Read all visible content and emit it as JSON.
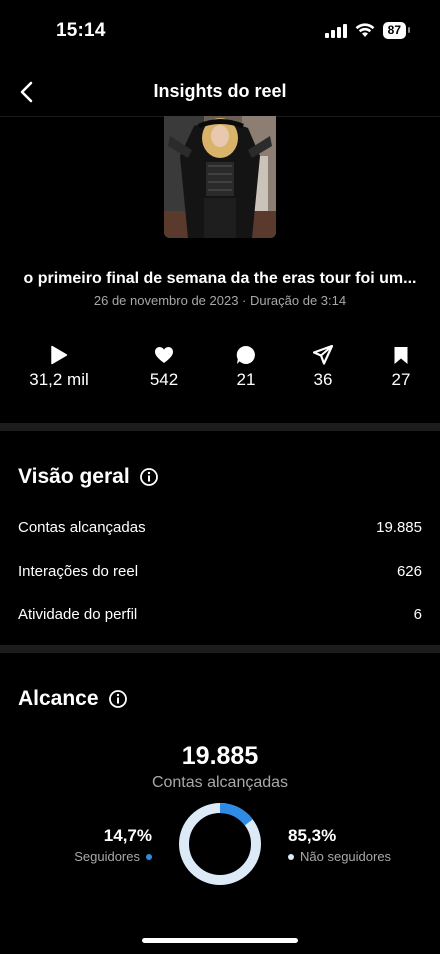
{
  "status_bar": {
    "time": "15:14",
    "battery": "87"
  },
  "nav": {
    "title": "Insights do reel",
    "back_icon": "chevron-left-icon"
  },
  "reel": {
    "title": "o primeiro final de semana da the eras tour foi um...",
    "meta": "26 de novembro de 2023 · Duração de 3:14"
  },
  "stats": [
    {
      "icon": "play-icon",
      "value": "31,2 mil"
    },
    {
      "icon": "heart-icon",
      "value": "542"
    },
    {
      "icon": "comment-icon",
      "value": "21"
    },
    {
      "icon": "share-icon",
      "value": "36"
    },
    {
      "icon": "bookmark-icon",
      "value": "27"
    }
  ],
  "overview": {
    "title": "Visão geral",
    "rows": [
      {
        "label": "Contas alcançadas",
        "value": "19.885"
      },
      {
        "label": "Interações do reel",
        "value": "626"
      },
      {
        "label": "Atividade do perfil",
        "value": "6"
      }
    ]
  },
  "reach": {
    "title": "Alcance",
    "total": "19.885",
    "total_label": "Contas alcançadas",
    "followers_pct": "14,7%",
    "followers_label": "Seguidores",
    "followers_fraction": 0.147,
    "non_followers_pct": "85,3%",
    "non_followers_label": "Não seguidores",
    "colors": {
      "followers": "#2f8ce6",
      "non_followers": "#dce9f7"
    }
  }
}
